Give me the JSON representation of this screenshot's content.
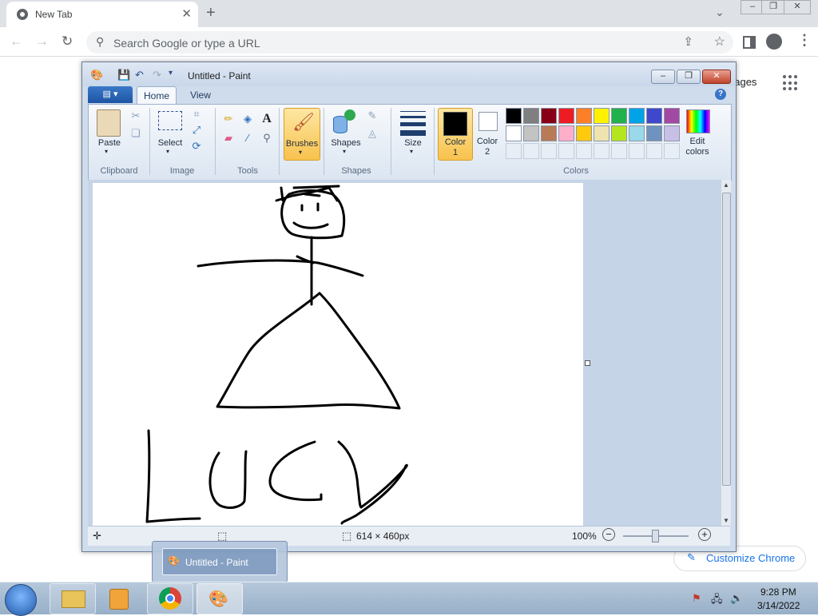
{
  "chrome": {
    "tab_title": "New Tab",
    "omnibox_placeholder": "Search Google or type a URL",
    "images_link": "nages",
    "customize_label": "Customize Chrome"
  },
  "paint": {
    "window_title": "Untitled - Paint",
    "tabs": [
      "Home",
      "View"
    ],
    "groups": {
      "clipboard": "Clipboard",
      "image": "Image",
      "tools": "Tools",
      "shapes": "Shapes",
      "colors": "Colors"
    },
    "buttons": {
      "paste": "Paste",
      "select": "Select",
      "brushes": "Brushes",
      "shapes": "Shapes",
      "size": "Size",
      "color1_line1": "Color",
      "color1_line2": "1",
      "color2_line1": "Color",
      "color2_line2": "2",
      "edit_colors_line1": "Edit",
      "edit_colors_line2": "colors"
    },
    "palette_row1": [
      "#000000",
      "#7f7f7f",
      "#880015",
      "#ed1c24",
      "#ff7f27",
      "#fff200",
      "#22b14c",
      "#00a2e8",
      "#3f48cc",
      "#a349a4"
    ],
    "palette_row2": [
      "#ffffff",
      "#c3c3c3",
      "#b97a57",
      "#ffaec9",
      "#ffc90e",
      "#efe4b0",
      "#b5e61d",
      "#99d9ea",
      "#7092be",
      "#c8bfe7"
    ],
    "color1": "#000000",
    "color2": "#ffffff",
    "status": {
      "canvas_size": "614 × 460px",
      "zoom": "100%"
    },
    "drawing_text": "LUCY"
  },
  "taskbar": {
    "thumbnail_label": "Untitled - Paint",
    "time": "9:28 PM",
    "date": "3/14/2022"
  }
}
